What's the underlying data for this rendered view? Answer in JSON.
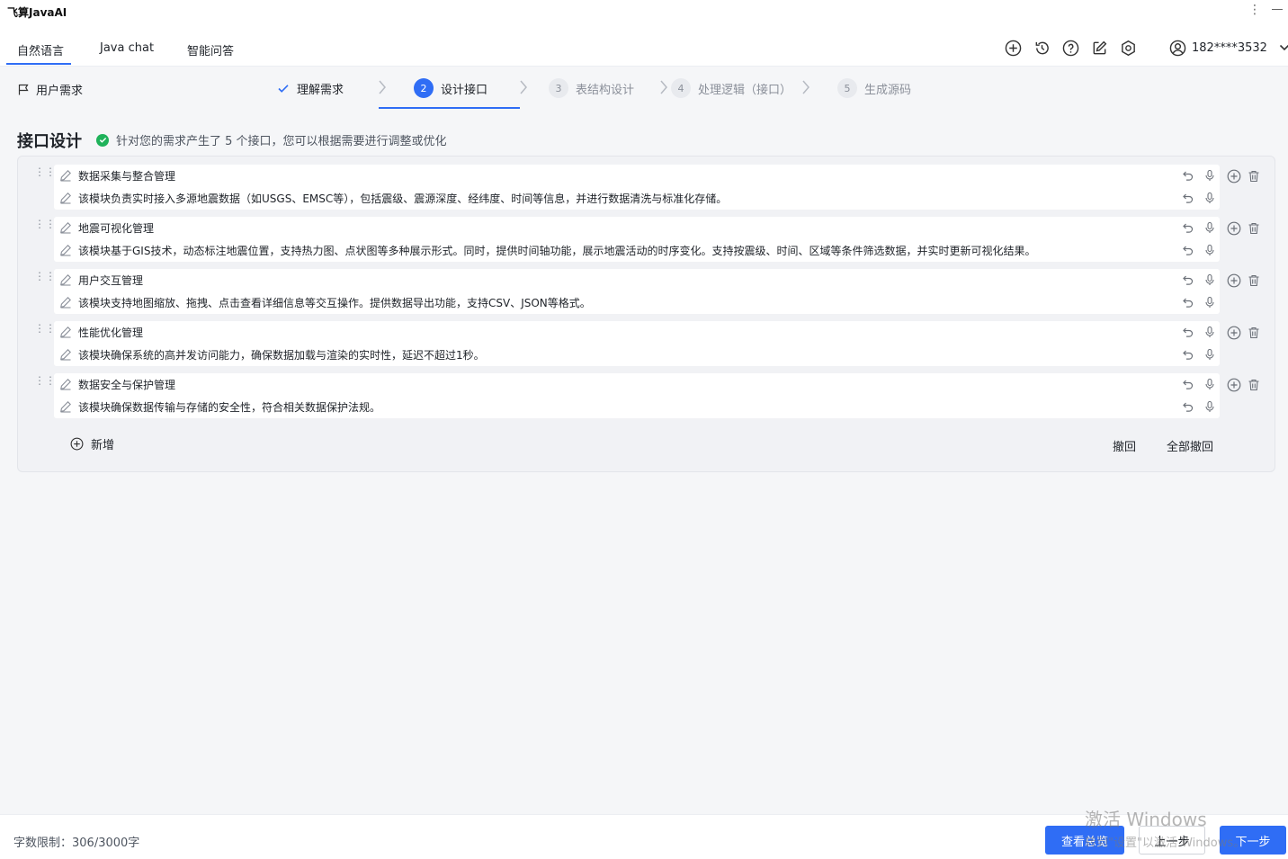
{
  "app": {
    "title": "飞算JavaAI",
    "more_glyph": "⋮"
  },
  "nav": {
    "tabs": [
      {
        "label": "自然语言"
      },
      {
        "label": "Java chat"
      },
      {
        "label": "智能问答"
      }
    ],
    "icons": [
      "plus-circle-icon",
      "history-icon",
      "help-icon",
      "edit-icon",
      "settings-icon"
    ],
    "user": {
      "name": "182****3532"
    }
  },
  "requirement": {
    "label": "用户需求"
  },
  "steps": [
    {
      "num": "1",
      "label": "理解需求",
      "state": "done"
    },
    {
      "num": "2",
      "label": "设计接口",
      "state": "active"
    },
    {
      "num": "3",
      "label": "表结构设计",
      "state": "pending"
    },
    {
      "num": "4",
      "label": "处理逻辑（接口）",
      "state": "pending"
    },
    {
      "num": "5",
      "label": "生成源码",
      "state": "pending"
    }
  ],
  "section": {
    "title": "接口设计",
    "hint": "针对您的需求产生了 5 个接口，您可以根据需要进行调整或优化"
  },
  "interfaces": [
    {
      "name": "数据采集与整合管理",
      "desc": "该模块负责实时接入多源地震数据（如USGS、EMSC等），包括震级、震源深度、经纬度、时间等信息，并进行数据清洗与标准化存储。"
    },
    {
      "name": "地震可视化管理",
      "desc": "该模块基于GIS技术，动态标注地震位置，支持热力图、点状图等多种展示形式。同时，提供时间轴功能，展示地震活动的时序变化。支持按震级、时间、区域等条件筛选数据，并实时更新可视化结果。"
    },
    {
      "name": "用户交互管理",
      "desc": "该模块支持地图缩放、拖拽、点击查看详细信息等交互操作。提供数据导出功能，支持CSV、JSON等格式。"
    },
    {
      "name": "性能优化管理",
      "desc": "该模块确保系统的高并发访问能力，确保数据加载与渲染的实时性，延迟不超过1秒。"
    },
    {
      "name": "数据安全与保护管理",
      "desc": "该模块确保数据传输与存储的安全性，符合相关数据保护法规。"
    }
  ],
  "actions": {
    "add": "新增",
    "undo": "撤回",
    "undo_all": "全部撤回"
  },
  "footer": {
    "char_limit": "字数限制：306/3000字",
    "overview": "查看总览",
    "prev": "上一步",
    "next": "下一步"
  },
  "watermark": {
    "line1": "激活 Windows",
    "line2": "转到\"设置\"以激活 Windows。"
  },
  "colors": {
    "accent": "#2f6df5",
    "success": "#1fb25a",
    "background": "#f5f6f8"
  }
}
